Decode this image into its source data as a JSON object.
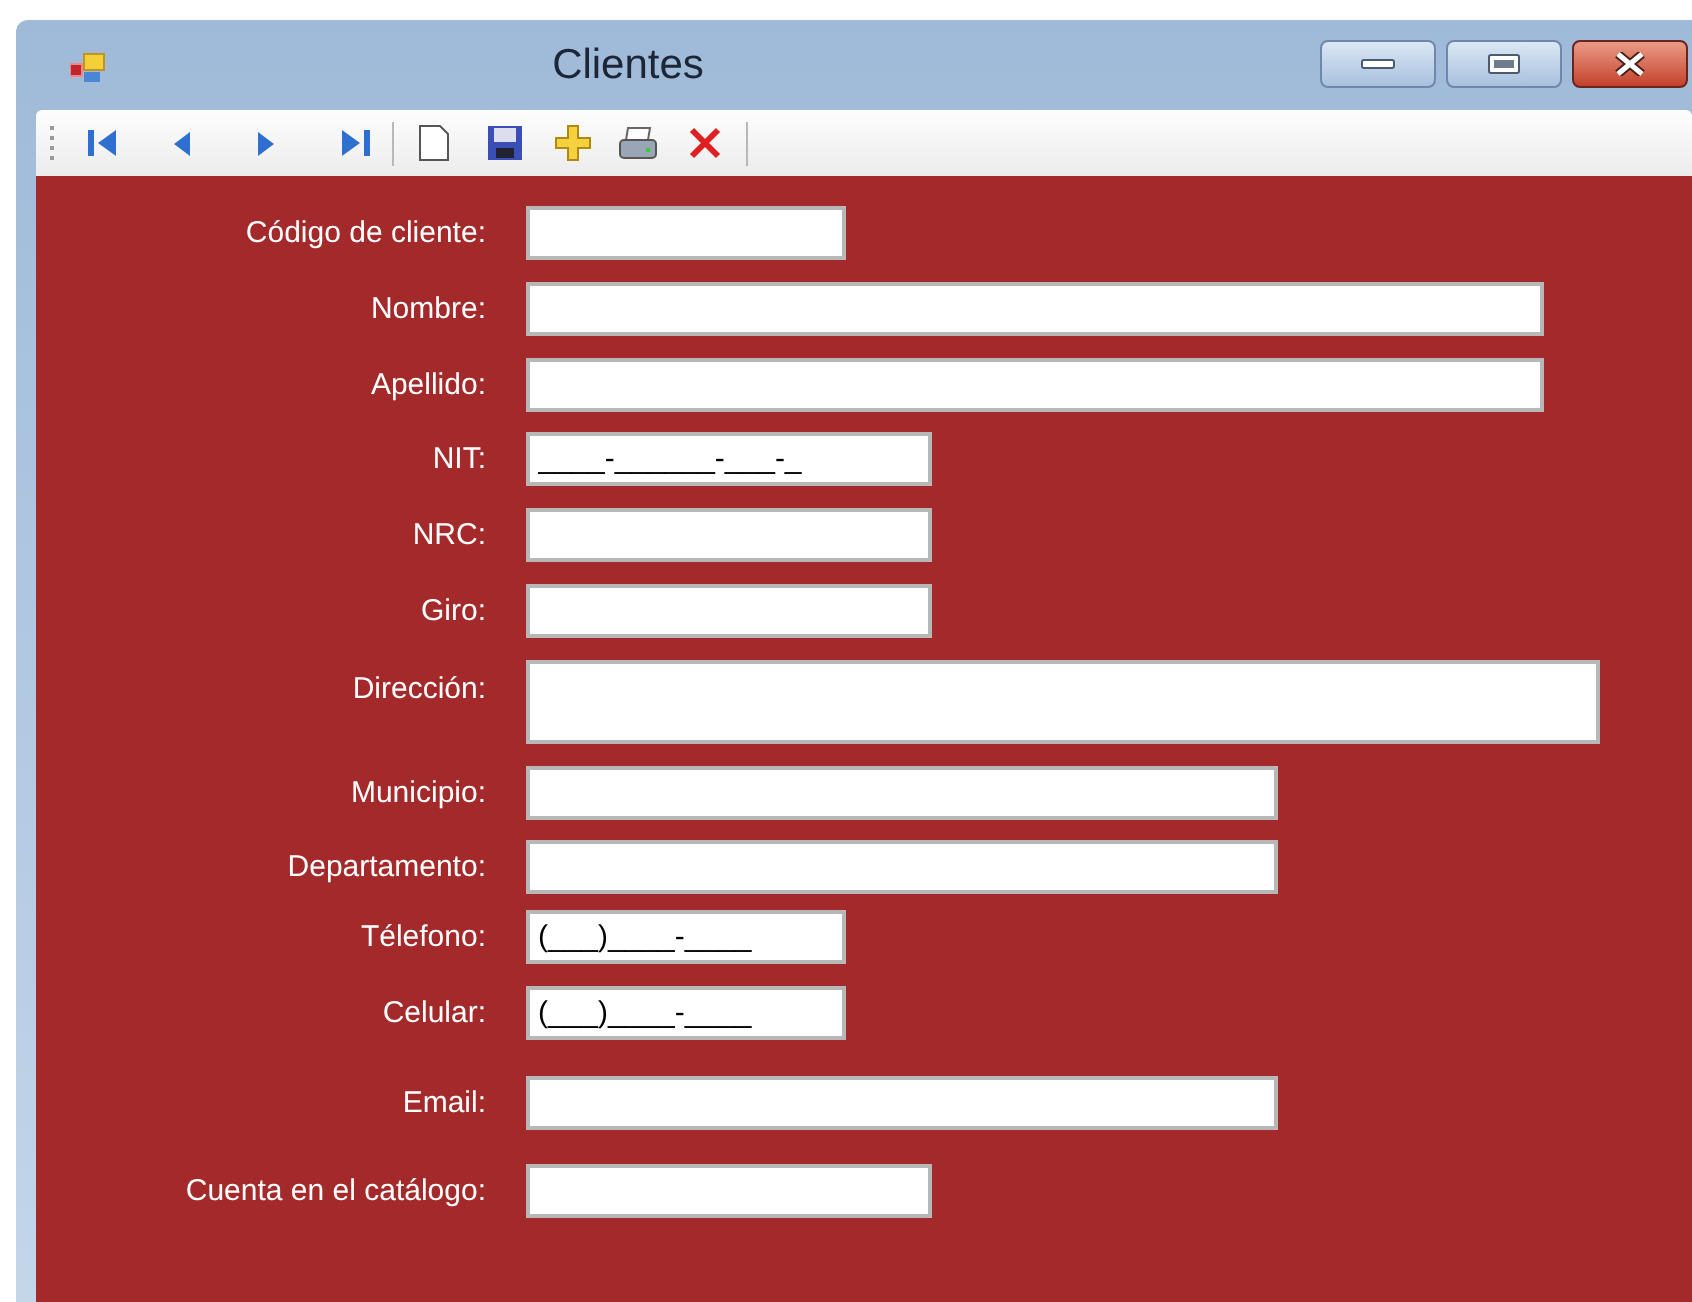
{
  "window": {
    "title": "Clientes"
  },
  "toolbar": [
    {
      "kind": "first"
    },
    {
      "kind": "prev"
    },
    {
      "kind": "next"
    },
    {
      "kind": "last"
    },
    {
      "kind": "sep"
    },
    {
      "kind": "new"
    },
    {
      "kind": "save"
    },
    {
      "kind": "add"
    },
    {
      "kind": "print"
    },
    {
      "kind": "delete"
    },
    {
      "kind": "sep"
    }
  ],
  "fields": [
    {
      "label": "Código de cliente:",
      "kind": "text"
    },
    {
      "label": "Nombre:",
      "kind": "text"
    },
    {
      "label": "Apellido:",
      "kind": "text"
    },
    {
      "label": "NIT:",
      "kind": "text",
      "value": "____-______-___-_"
    },
    {
      "label": "NRC:",
      "kind": "text"
    },
    {
      "label": "Giro:",
      "kind": "text"
    },
    {
      "label": "Dirección:",
      "kind": "multiline"
    },
    {
      "label": "Municipio:",
      "kind": "text"
    },
    {
      "label": "Departamento:",
      "kind": "text"
    },
    {
      "label": "Télefono:",
      "kind": "text",
      "value": "(___)____-____"
    },
    {
      "label": "Celular:",
      "kind": "text",
      "value": "(___)____-____"
    },
    {
      "label": "Email:",
      "kind": "text"
    },
    {
      "label": "Cuenta en el catálogo:",
      "kind": "text"
    }
  ]
}
